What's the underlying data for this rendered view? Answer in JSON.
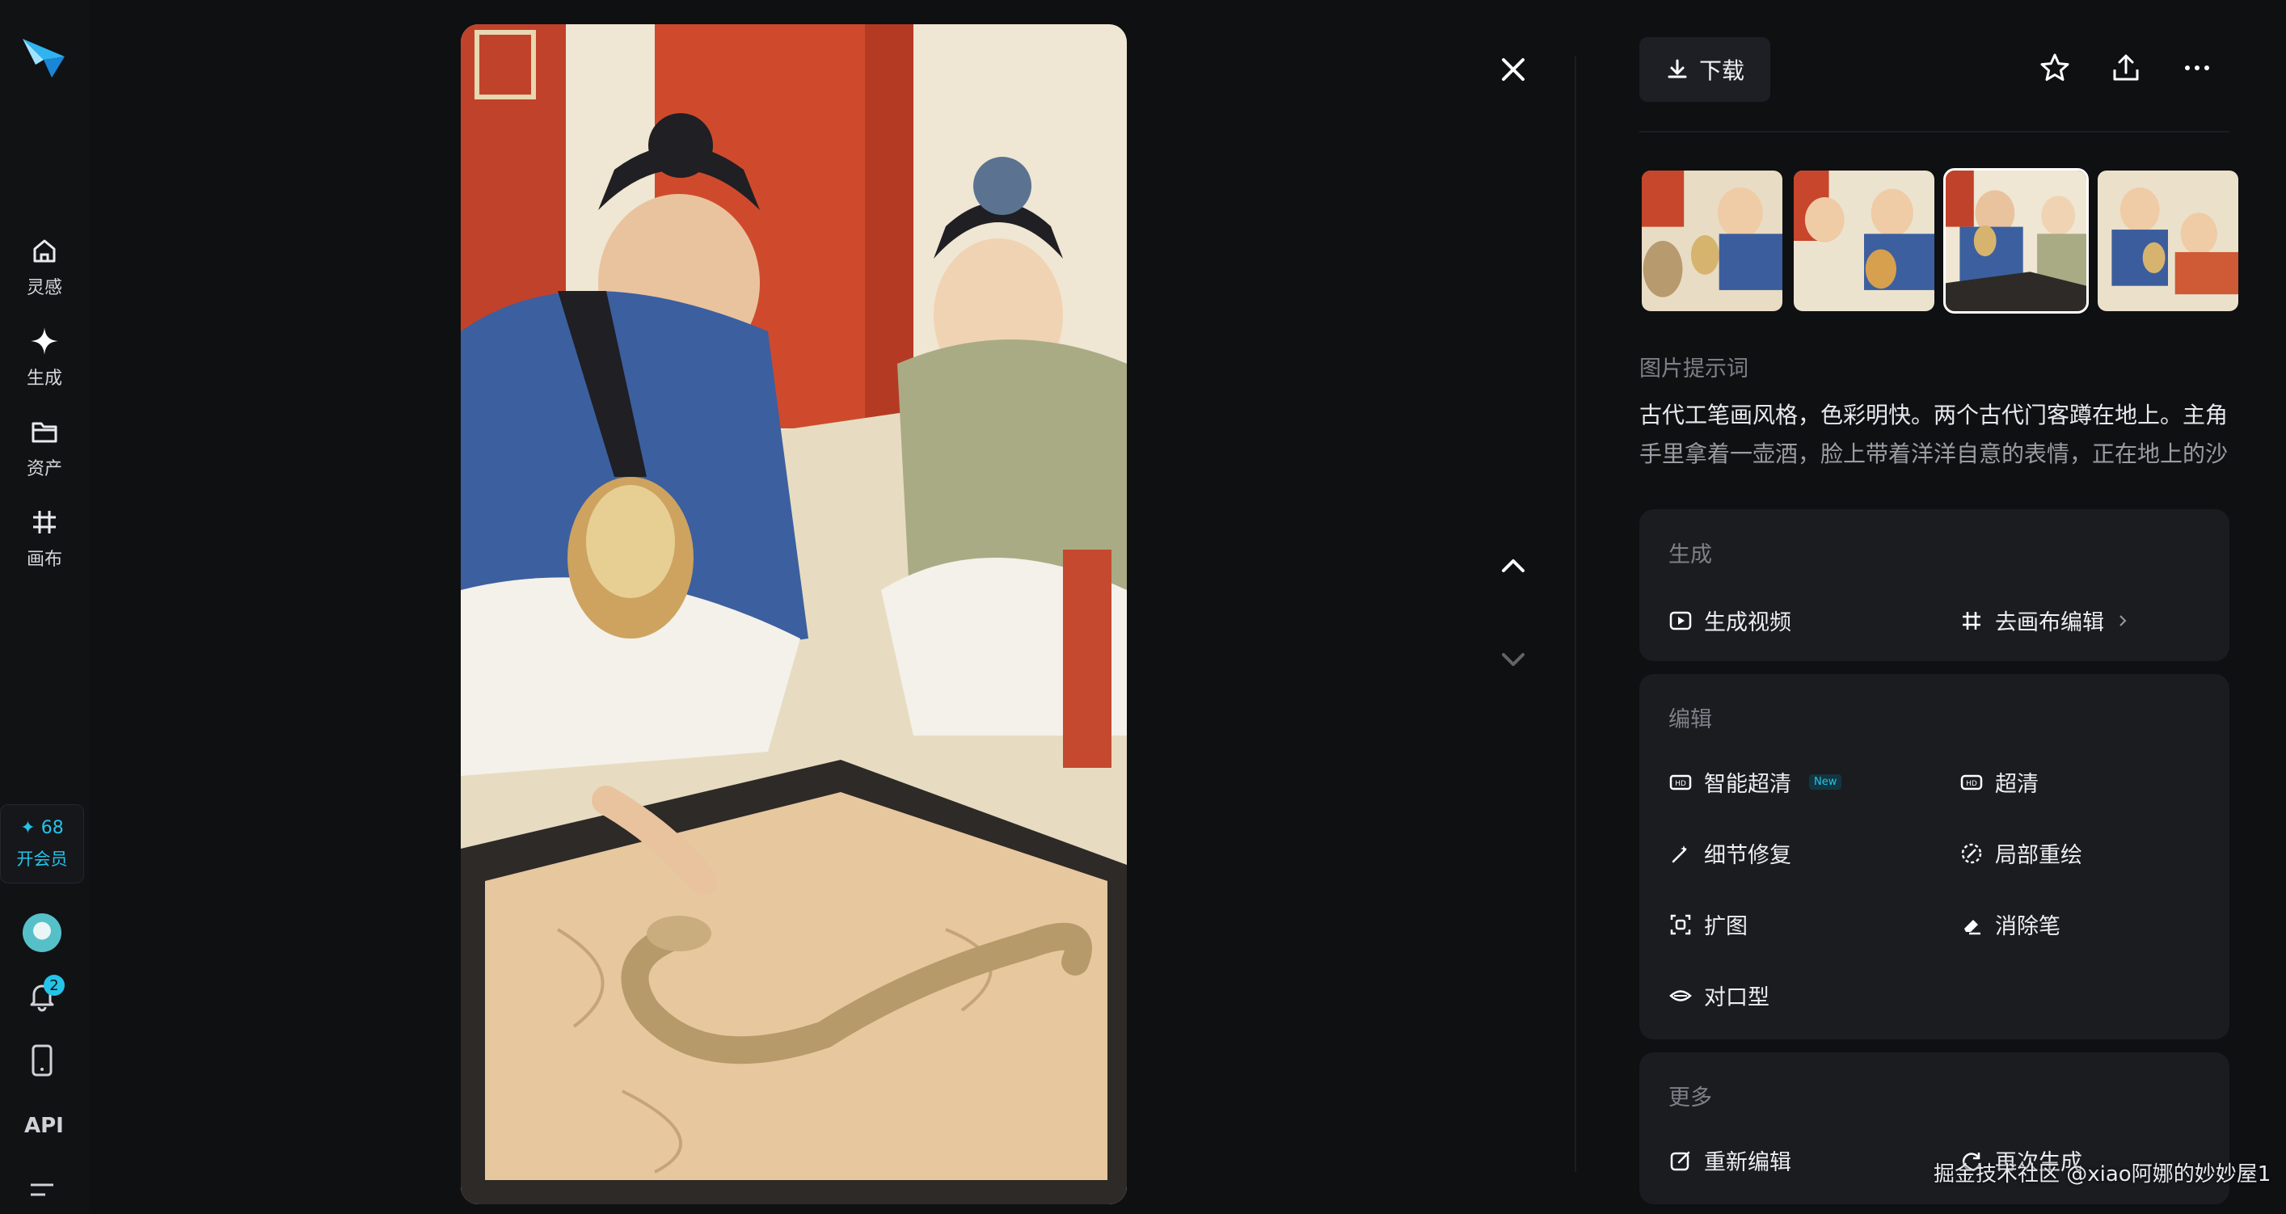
{
  "sidebar": {
    "items": [
      {
        "label": "灵感",
        "icon": "home-icon"
      },
      {
        "label": "生成",
        "icon": "sparkle-icon"
      },
      {
        "label": "资产",
        "icon": "folder-icon"
      },
      {
        "label": "画布",
        "icon": "canvas-icon"
      }
    ],
    "credits": "68",
    "vip_label": "开会员",
    "notification_count": "2",
    "api_label": "API"
  },
  "toolbar": {
    "download_label": "下载"
  },
  "prompt": {
    "title": "图片提示词",
    "line1": "古代工笔画风格，色彩明快。两个古代门客蹲在地上。主角",
    "line2": "手里拿着一壶酒，脸上带着洋洋自意的表情，正在地上的沙"
  },
  "generate_card": {
    "title": "生成",
    "video_label": "生成视频",
    "canvas_label": "去画布编辑"
  },
  "edit_card": {
    "title": "编辑",
    "smart_hd": "智能超清",
    "new_tag": "New",
    "hd": "超清",
    "detail_fix": "细节修复",
    "inpaint": "局部重绘",
    "expand": "扩图",
    "eraser": "消除笔",
    "lipsync": "对口型"
  },
  "more_card": {
    "title": "更多",
    "re_edit": "重新编辑",
    "regenerate": "再次生成"
  },
  "watermark": "掘金技术社区 @xiao阿娜的妙妙屋1",
  "colors": {
    "accent": "#23c4e8",
    "background": "#0f1012",
    "card": "#1a1c20"
  }
}
